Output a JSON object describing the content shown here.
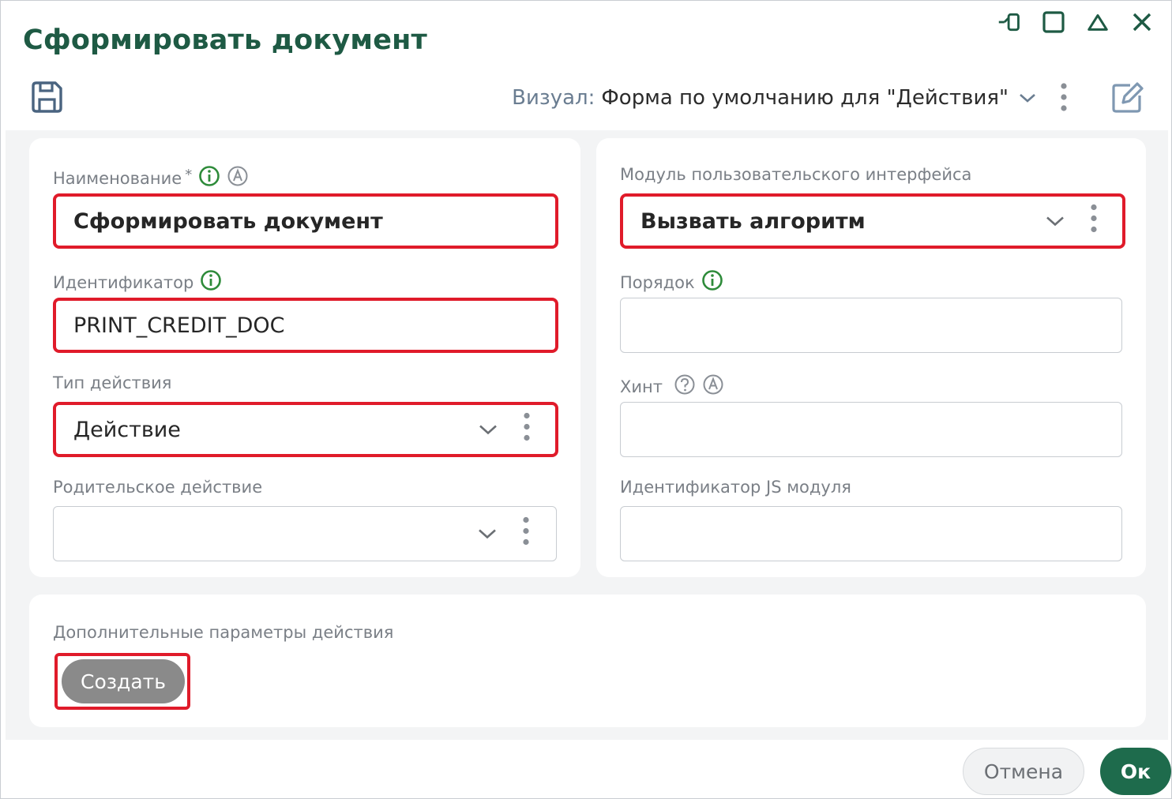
{
  "window": {
    "title": "Сформировать документ"
  },
  "toolbar": {
    "visual_label": "Визуал:",
    "visual_value": "Форма по умолчанию для \"Действия\""
  },
  "left": {
    "name": {
      "label": "Наименование",
      "required_mark": "*",
      "value": "Сформировать документ"
    },
    "identifier": {
      "label": "Идентификатор",
      "value": "PRINT_CREDIT_DOC"
    },
    "action_type": {
      "label": "Тип действия",
      "value": "Действие"
    },
    "parent_action": {
      "label": "Родительское действие",
      "value": ""
    }
  },
  "right": {
    "ui_module": {
      "label": "Модуль пользовательского интерфейса",
      "value": "Вызвать алгоритм"
    },
    "order": {
      "label": "Порядок",
      "value": ""
    },
    "hint": {
      "label": "Хинт",
      "value": ""
    },
    "js_module_id": {
      "label": "Идентификатор JS модуля",
      "value": ""
    }
  },
  "extra": {
    "label": "Дополнительные параметры действия",
    "create_label": "Создать"
  },
  "footer": {
    "cancel_label": "Отмена",
    "ok_label": "Ок"
  },
  "colors": {
    "brand_green": "#1e5a44",
    "ok_button": "#1e6b4c",
    "info_icon": "#2e8b3a",
    "highlight": "#e01b2a"
  },
  "icons": [
    "restore-down-icon",
    "maximize-icon",
    "collapse-icon",
    "close-icon",
    "save-icon",
    "chevron-down-icon",
    "more-vertical-icon",
    "edit-icon",
    "info-icon",
    "auto-icon",
    "help-icon"
  ]
}
